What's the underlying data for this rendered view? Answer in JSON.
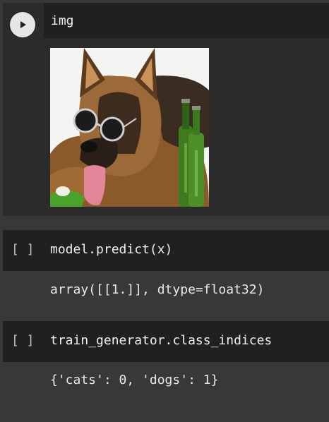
{
  "cells": [
    {
      "code": "img",
      "run_icon": "play-icon",
      "output_image": "german shepherd dog with sunglasses and green bottles"
    },
    {
      "prompt": "[ ]",
      "code": "model.predict(x)",
      "output": "array([[1.]], dtype=float32)"
    },
    {
      "prompt": "[ ]",
      "code": "train_generator.class_indices",
      "output": "{'cats': 0, 'dogs': 1}"
    }
  ],
  "colors": {
    "page_bg": "#383838",
    "code_row_bg": "#202020",
    "cell_bg": "#2b2b2b",
    "text": "#f0f0f0",
    "run_button": "#e6e6e6"
  }
}
